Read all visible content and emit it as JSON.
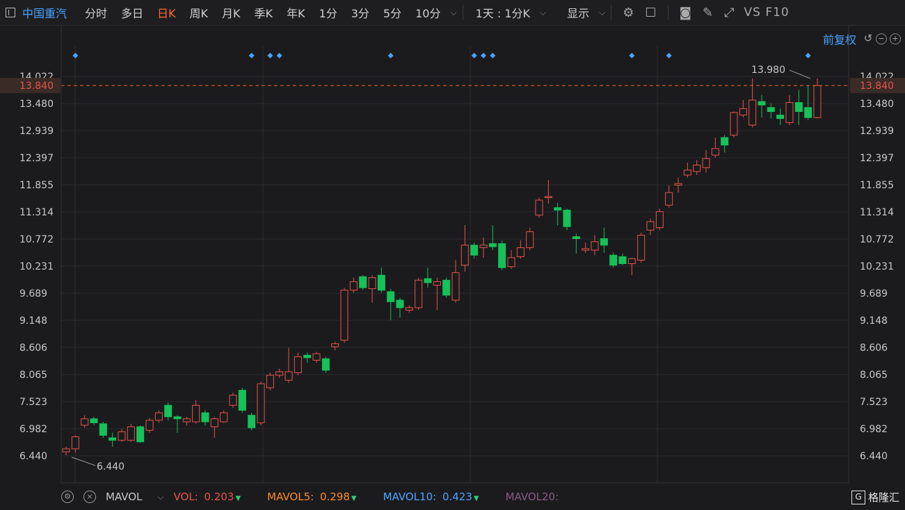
{
  "toolbar": {
    "stock_name": "中国重汽",
    "tabs": [
      "分时",
      "多日",
      "日K",
      "周K",
      "月K",
      "季K",
      "年K",
      "1分",
      "3分",
      "5分",
      "10分"
    ],
    "active_tab": "日K",
    "period_select": "1天 : 1分K",
    "display_label": "显示",
    "vs_f10": "VS F10"
  },
  "chart_controls": {
    "adjust_label": "前复权"
  },
  "colors": {
    "up": "#e8534b",
    "down": "#16c15a",
    "accent": "#4aa3ff",
    "price_line": "#e86a2b"
  },
  "chart_data": {
    "type": "candlestick",
    "y_ticks": [
      "14.022",
      "13.480",
      "12.939",
      "12.397",
      "11.855",
      "11.314",
      "10.772",
      "10.231",
      "9.689",
      "9.148",
      "8.606",
      "8.065",
      "7.523",
      "6.982",
      "6.440"
    ],
    "ylim": [
      6.44,
      14.022
    ],
    "current_price": "13.840",
    "high_label": "13.980",
    "low_label": "6.440",
    "marker_indices": [
      1,
      20,
      22,
      23,
      35,
      44,
      45,
      46,
      61,
      65,
      80
    ],
    "candles": [
      [
        6.52,
        6.58,
        6.62,
        6.45
      ],
      [
        6.58,
        6.82,
        6.85,
        6.5
      ],
      [
        7.05,
        7.18,
        7.25,
        7.0
      ],
      [
        7.18,
        7.1,
        7.22,
        7.05
      ],
      [
        7.08,
        6.85,
        7.12,
        6.8
      ],
      [
        6.8,
        6.75,
        6.9,
        6.62
      ],
      [
        6.75,
        6.92,
        6.98,
        6.72
      ],
      [
        6.75,
        7.02,
        7.08,
        6.72
      ],
      [
        7.02,
        6.72,
        7.05,
        6.7
      ],
      [
        6.95,
        7.15,
        7.2,
        6.9
      ],
      [
        7.15,
        7.3,
        7.35,
        7.1
      ],
      [
        7.45,
        7.22,
        7.5,
        7.15
      ],
      [
        7.22,
        7.18,
        7.25,
        6.9
      ],
      [
        7.12,
        7.18,
        7.22,
        7.05
      ],
      [
        7.12,
        7.45,
        7.55,
        7.08
      ],
      [
        7.3,
        7.12,
        7.35,
        7.05
      ],
      [
        7.02,
        7.18,
        7.22,
        6.8
      ],
      [
        7.12,
        7.3,
        7.35,
        7.1
      ],
      [
        7.45,
        7.65,
        7.7,
        7.4
      ],
      [
        7.75,
        7.35,
        7.8,
        7.3
      ],
      [
        7.25,
        7.0,
        7.3,
        6.95
      ],
      [
        7.1,
        7.88,
        7.92,
        7.05
      ],
      [
        7.8,
        8.05,
        8.1,
        7.75
      ],
      [
        8.05,
        8.12,
        8.18,
        8.0
      ],
      [
        7.95,
        8.12,
        8.6,
        7.9
      ],
      [
        8.1,
        8.42,
        8.5,
        8.05
      ],
      [
        8.45,
        8.4,
        8.5,
        8.3
      ],
      [
        8.35,
        8.48,
        8.52,
        8.3
      ],
      [
        8.38,
        8.15,
        8.42,
        8.1
      ],
      [
        8.62,
        8.68,
        8.72,
        8.55
      ],
      [
        8.75,
        9.75,
        9.8,
        8.7
      ],
      [
        9.75,
        9.92,
        10.0,
        9.7
      ],
      [
        10.02,
        9.8,
        10.05,
        9.75
      ],
      [
        9.78,
        10.0,
        10.05,
        9.5
      ],
      [
        10.05,
        9.75,
        10.2,
        9.7
      ],
      [
        9.72,
        9.52,
        9.78,
        9.15
      ],
      [
        9.55,
        9.4,
        9.6,
        9.2
      ],
      [
        9.35,
        9.4,
        9.45,
        9.3
      ],
      [
        9.4,
        9.95,
        10.0,
        9.35
      ],
      [
        9.98,
        9.9,
        10.2,
        9.8
      ],
      [
        9.85,
        9.92,
        10.0,
        9.35
      ],
      [
        9.95,
        9.65,
        10.0,
        9.6
      ],
      [
        9.55,
        10.1,
        10.35,
        9.5
      ],
      [
        10.25,
        10.65,
        11.05,
        10.12
      ],
      [
        10.65,
        10.45,
        10.7,
        10.38
      ],
      [
        10.6,
        10.65,
        10.8,
        10.4
      ],
      [
        10.68,
        10.62,
        11.05,
        10.55
      ],
      [
        10.68,
        10.2,
        10.75,
        10.15
      ],
      [
        10.22,
        10.4,
        10.55,
        10.18
      ],
      [
        10.42,
        10.6,
        10.75,
        10.38
      ],
      [
        10.6,
        10.92,
        11.0,
        10.55
      ],
      [
        11.25,
        11.55,
        11.6,
        11.2
      ],
      [
        11.6,
        11.62,
        11.95,
        11.48
      ],
      [
        11.4,
        11.35,
        11.5,
        11.05
      ],
      [
        11.35,
        11.02,
        11.38,
        10.95
      ],
      [
        10.82,
        10.78,
        10.88,
        10.48
      ],
      [
        10.55,
        10.58,
        10.7,
        10.5
      ],
      [
        10.55,
        10.72,
        10.85,
        10.45
      ],
      [
        10.78,
        10.65,
        11.0,
        10.5
      ],
      [
        10.45,
        10.25,
        10.5,
        10.2
      ],
      [
        10.42,
        10.28,
        10.48,
        10.25
      ],
      [
        10.28,
        10.38,
        10.4,
        10.05
      ],
      [
        10.35,
        10.85,
        10.9,
        10.3
      ],
      [
        10.95,
        11.12,
        11.18,
        10.85
      ],
      [
        11.0,
        11.32,
        11.38,
        10.95
      ],
      [
        11.45,
        11.7,
        11.85,
        11.4
      ],
      [
        11.85,
        11.88,
        12.0,
        11.7
      ],
      [
        12.05,
        12.15,
        12.3,
        12.0
      ],
      [
        12.12,
        12.25,
        12.35,
        12.05
      ],
      [
        12.2,
        12.38,
        12.55,
        12.1
      ],
      [
        12.45,
        12.58,
        12.8,
        12.4
      ],
      [
        12.8,
        12.65,
        12.85,
        12.5
      ],
      [
        12.85,
        13.3,
        13.32,
        12.8
      ],
      [
        13.25,
        13.38,
        13.55,
        13.2
      ],
      [
        13.05,
        13.55,
        13.98,
        13.0
      ],
      [
        13.52,
        13.45,
        13.65,
        13.2
      ],
      [
        13.4,
        13.32,
        13.48,
        13.18
      ],
      [
        13.25,
        13.18,
        13.38,
        13.05
      ],
      [
        13.1,
        13.5,
        13.65,
        13.05
      ],
      [
        13.5,
        13.32,
        13.75,
        13.05
      ],
      [
        13.4,
        13.2,
        13.85,
        13.15
      ],
      [
        13.2,
        13.84,
        13.98,
        13.18
      ]
    ]
  },
  "indicators": {
    "name": "MAVOL",
    "vol_label": "VOL:",
    "vol_value": "0.203",
    "mavol5_label": "MAVOL5:",
    "mavol5_value": "0.298",
    "mavol10_label": "MAVOL10:",
    "mavol10_value": "0.423",
    "mavol20_label": "MAVOL20:"
  },
  "logo": {
    "text": "格隆汇"
  }
}
